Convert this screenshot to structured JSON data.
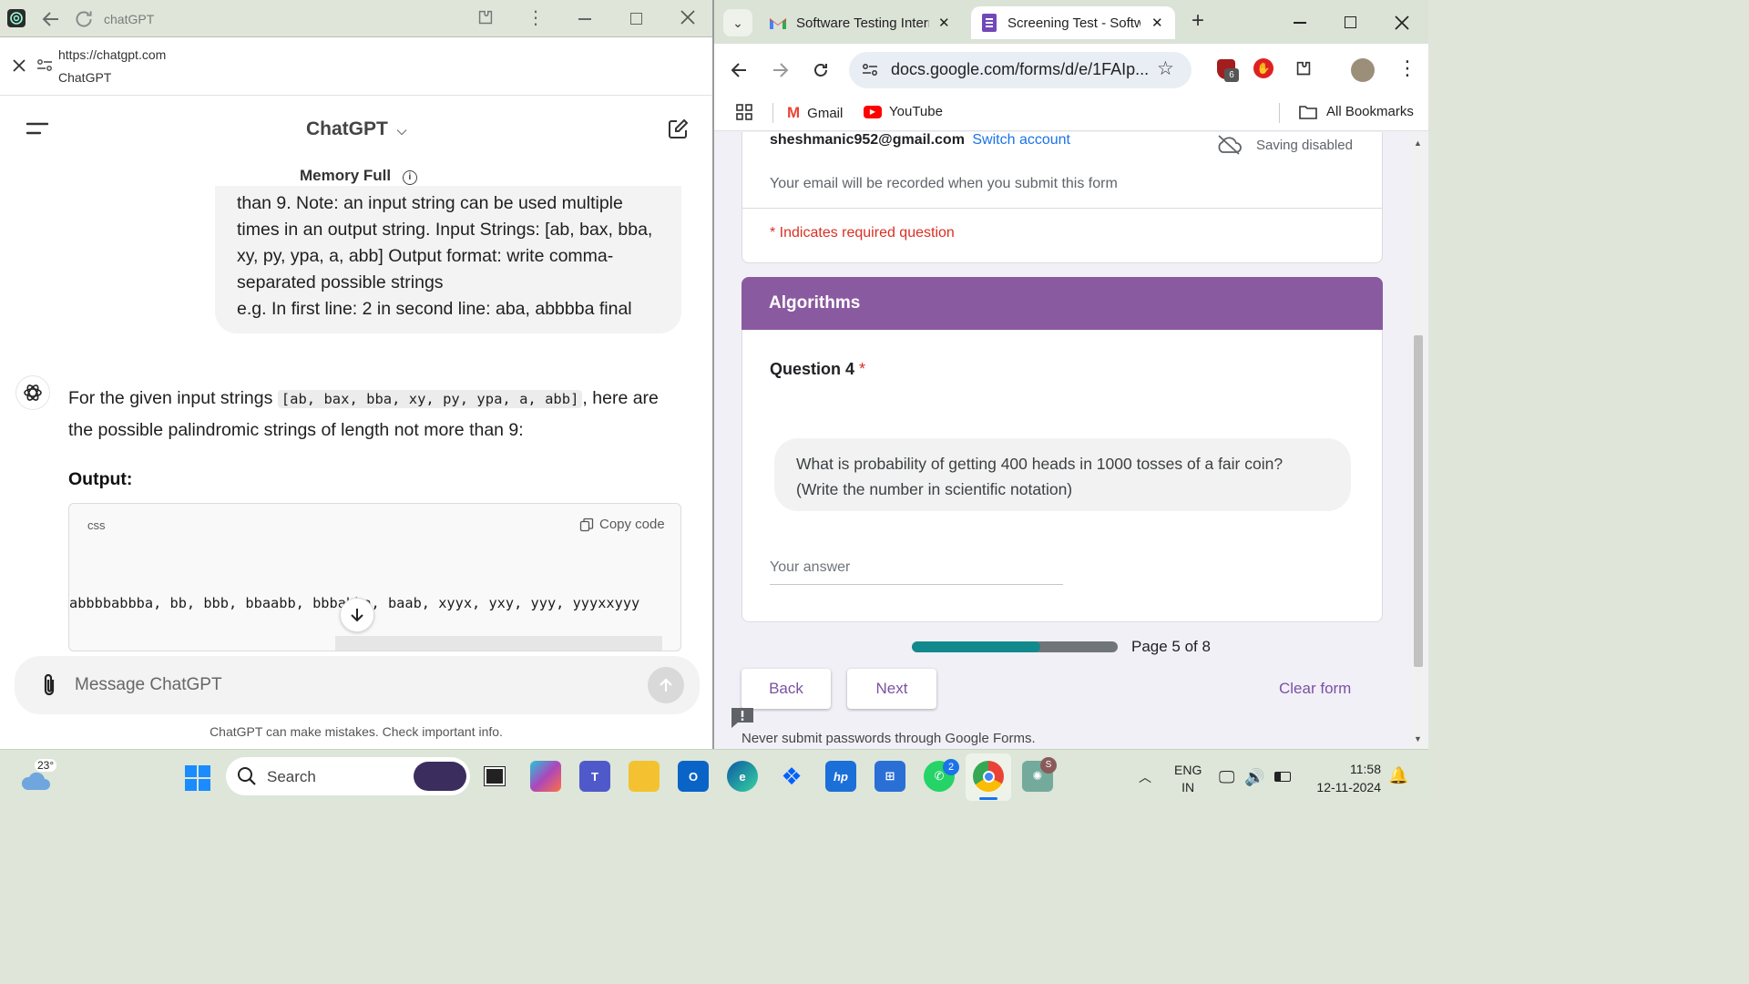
{
  "left_window": {
    "title": "chatGPT",
    "url": "https://chatgpt.com",
    "site_name": "ChatGPT",
    "header_title": "ChatGPT",
    "memory_label": "Memory Full",
    "user_message_lines": [
      "than 9. Note: an input string can be used multiple",
      "times in an output string. Input Strings: [ab, bax, bba,",
      "xy, py, ypa, a, abb] Output format: write comma-",
      "separated possible strings",
      "e.g. In first line: 2 in second line: aba, abbbba final"
    ],
    "assistant_intro_prefix": "For the given input strings",
    "assistant_intro_code": "[ab, bax, bba, xy, py, ypa, a, abb]",
    "assistant_intro_suffix": ", here are",
    "assistant_intro_line2": "the possible palindromic strings of length not more than 9:",
    "output_heading": "Output:",
    "code_lang": "css",
    "copy_label": "Copy code",
    "code_text": "abbbbabbba, bb, bbb, bbaabb, bbbabba, baab, xyyx, yxy, yyy, yyyxxyyy",
    "composer_placeholder": "Message ChatGPT",
    "disclaimer": "ChatGPT can make mistakes. Check important info."
  },
  "right_window": {
    "tabs": [
      {
        "label": "Software Testing Intern",
        "active": false
      },
      {
        "label": "Screening Test - Softw",
        "active": true
      }
    ],
    "address": "docs.google.com/forms/d/e/1FAIp...",
    "extension_badge": "6",
    "bookmarks": [
      "Gmail",
      "YouTube"
    ],
    "all_bookmarks": "All Bookmarks",
    "account_email": "sheshmanic952@gmail.com",
    "switch_account": "Switch account",
    "saving_status": "Saving disabled",
    "email_notice": "Your email will be recorded when you submit this form",
    "required_note": "* Indicates required question",
    "section_title": "Algorithms",
    "question_title": "Question 4",
    "question_required_mark": "*",
    "question_line1": "What is probability of getting 400 heads in 1000 tosses of a fair coin?",
    "question_line2": "(Write the number in scientific notation)",
    "answer_placeholder": "Your answer",
    "progress_fraction": 0.625,
    "page_label": "Page 5 of 8",
    "back_label": "Back",
    "next_label": "Next",
    "clear_label": "Clear form",
    "footer_note": "Never submit passwords through Google Forms.",
    "accent_color": "#8a5aa0"
  },
  "taskbar": {
    "weather_temp": "23°",
    "search_placeholder": "Search",
    "whatsapp_badge": "2",
    "lang_line1": "ENG",
    "lang_line2": "IN",
    "time": "11:58",
    "date": "12-11-2024"
  }
}
